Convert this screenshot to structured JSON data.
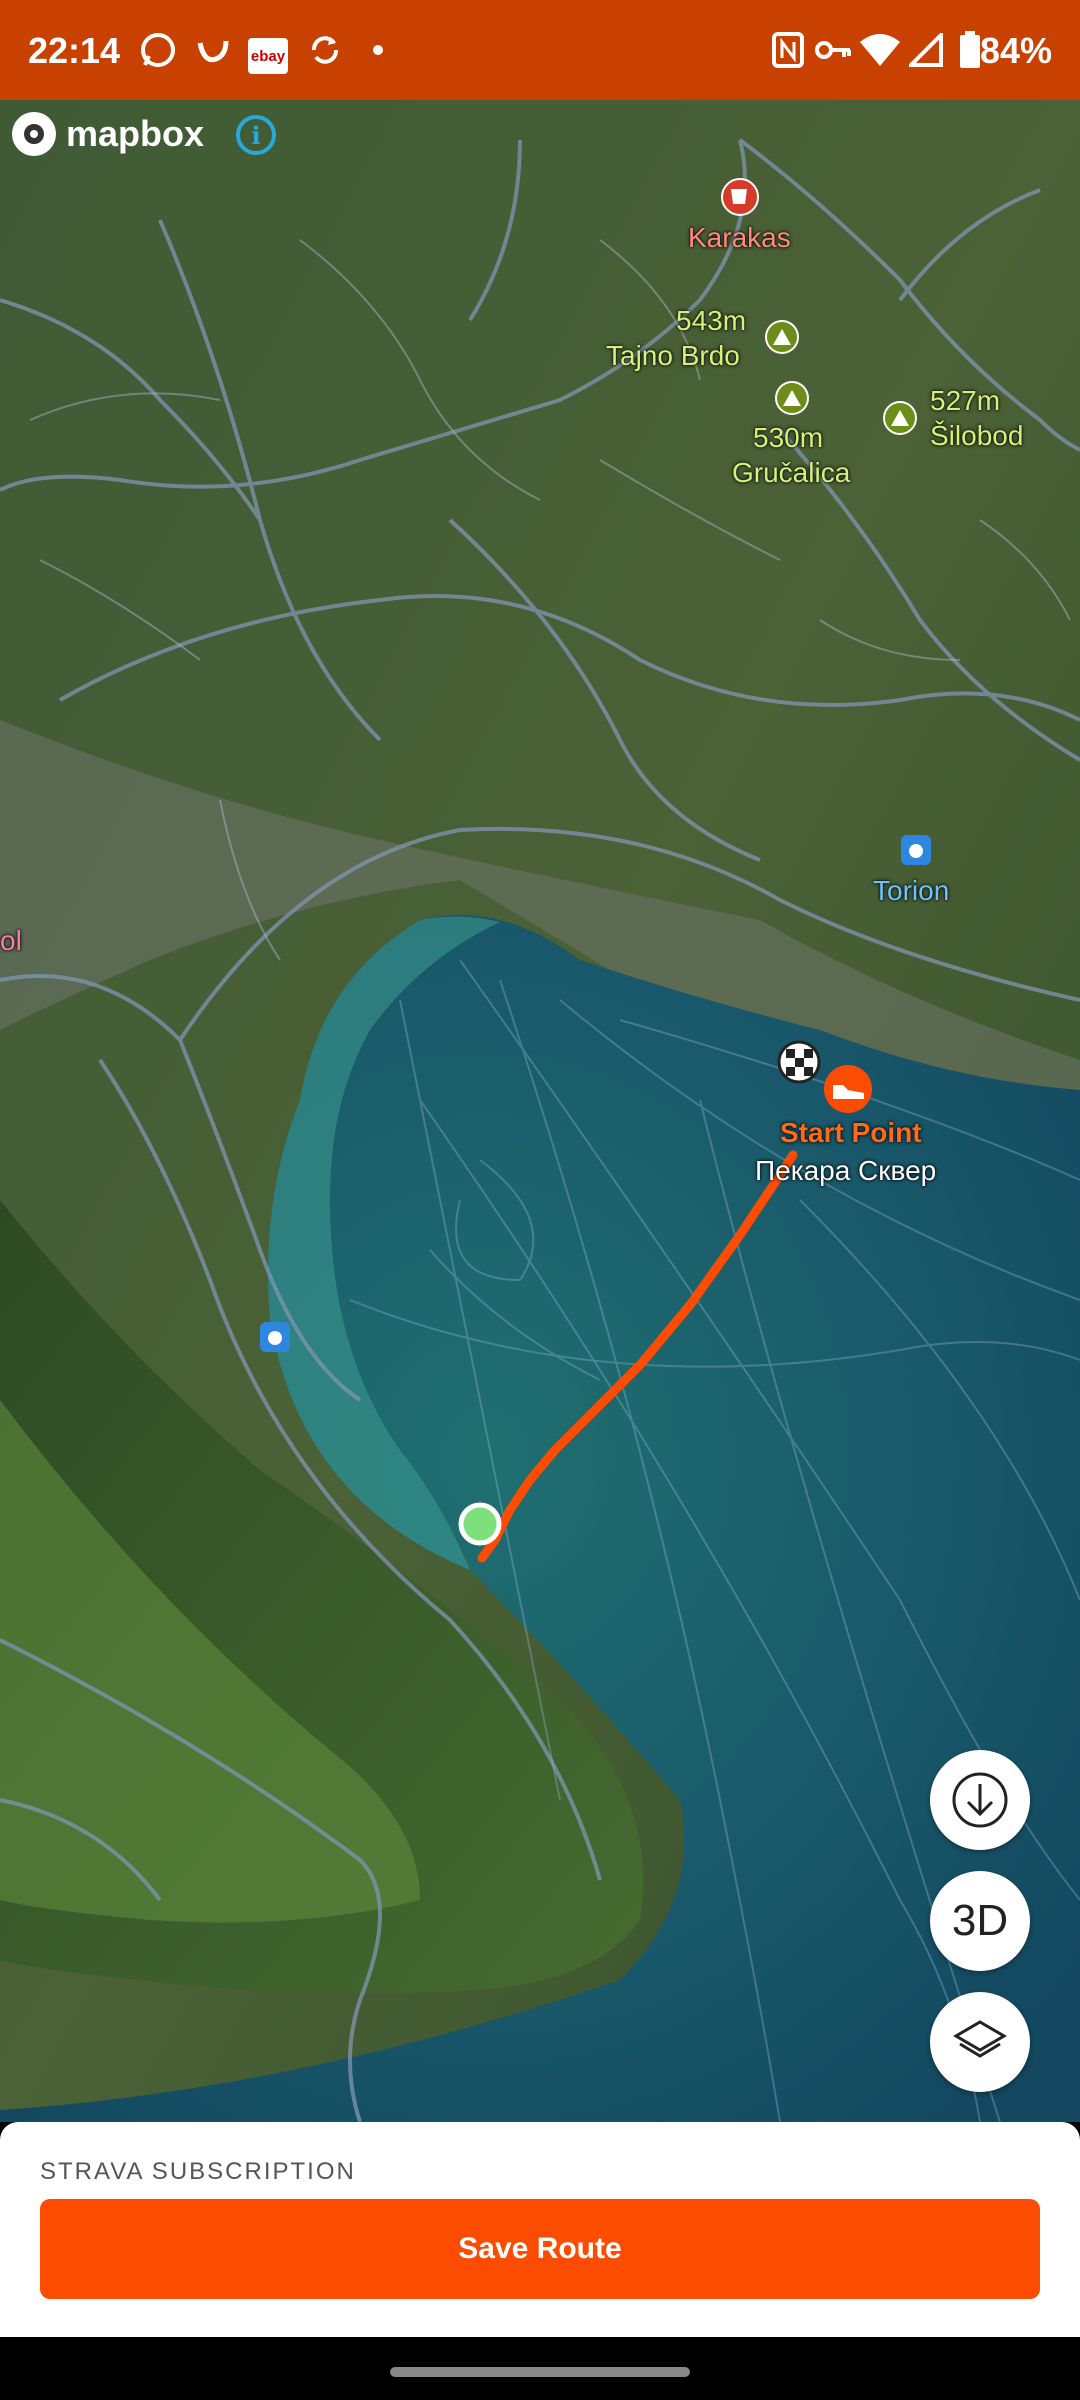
{
  "status_bar": {
    "time": "22:14",
    "battery": "84%",
    "left_icons": [
      "whatsapp-icon",
      "vpn-app-icon",
      "ebay-icon",
      "sync-icon",
      "dot-icon"
    ],
    "ebay_label": "ebay",
    "right_icons": [
      "nfc-icon",
      "key-icon",
      "wifi-icon",
      "signal-icon",
      "battery-icon"
    ]
  },
  "map": {
    "attribution": "mapbox",
    "labels": {
      "karakas": "Karakas",
      "peak1_elev": "543m",
      "peak1_name": "Tajno Brdo",
      "peak2_elev": "530m",
      "peak2_name": "Gručalica",
      "peak3_elev": "527m",
      "peak3_name": "Šilobod",
      "torion": "Torion",
      "partial_left": "ol",
      "start_point": "Start Point",
      "start_place": "Пекара Сквер"
    },
    "route_color": "#fc4c02",
    "controls": {
      "download_icon": "download-icon",
      "three_d_label": "3D",
      "layers_icon": "layers-icon"
    }
  },
  "bottom_sheet": {
    "caption": "STRAVA SUBSCRIPTION",
    "save_button": "Save Route"
  },
  "colors": {
    "status_bar": "#c94100",
    "accent": "#fc4c02"
  }
}
